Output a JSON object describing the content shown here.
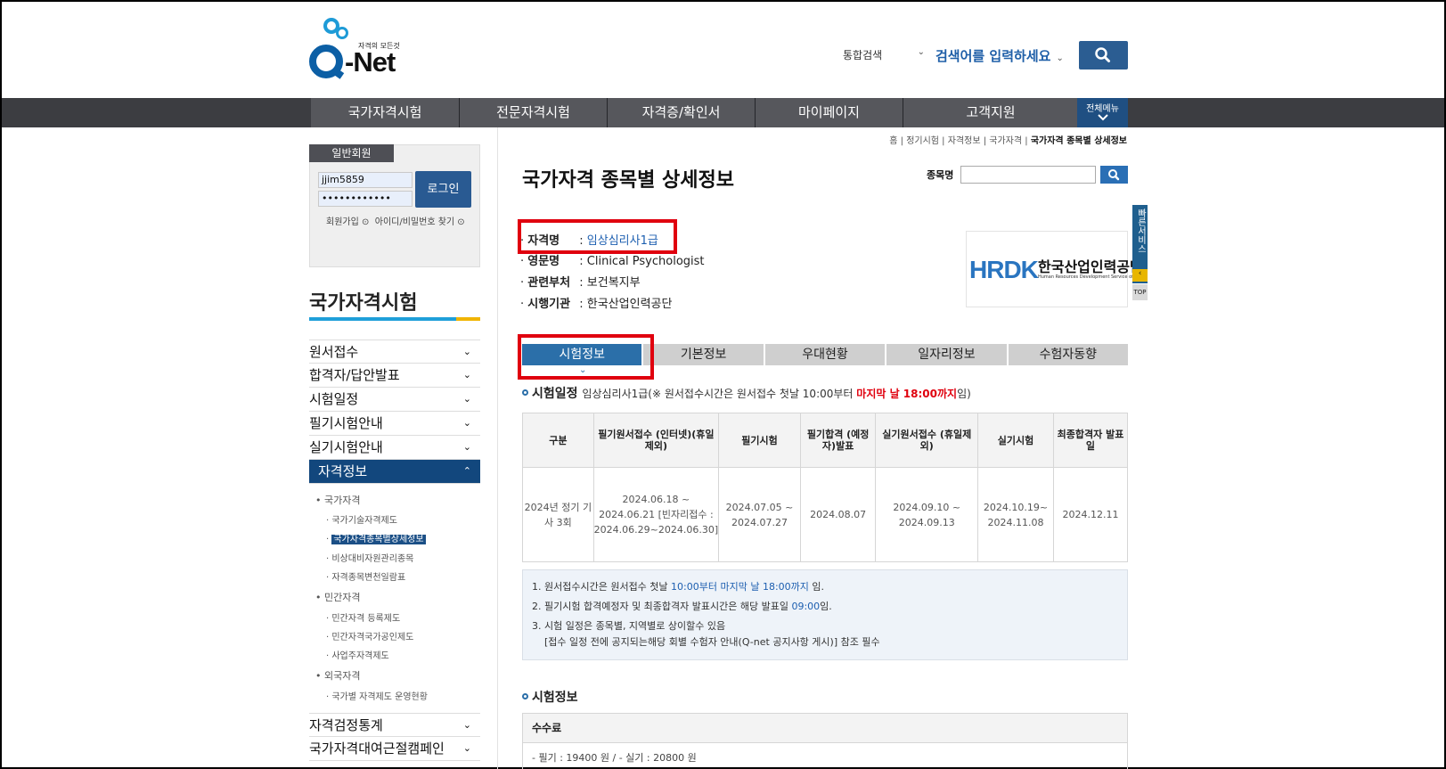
{
  "header": {
    "logo_tagline": "자격의 모든것",
    "logo_text": "-Net",
    "search_category": "통합검색",
    "search_placeholder": "검색어를 입력하세요"
  },
  "nav": {
    "items": [
      "국가자격시험",
      "전문자격시험",
      "자격증/확인서",
      "마이페이지",
      "고객지원"
    ],
    "all_menu": "전체메뉴"
  },
  "login": {
    "member_type": "일반회원",
    "user_id": "jjim5859",
    "password": "••••••••••••",
    "login_button": "로그인",
    "join": "회원가입",
    "find": "아이디/비밀번호 찾기"
  },
  "sidebar": {
    "title": "국가자격시험",
    "menu_top": [
      "원서접수",
      "합격자/답안발표",
      "시험일정",
      "필기시험안내",
      "실기시험안내"
    ],
    "active": "자격정보",
    "sub": [
      {
        "label": "국가자격",
        "level": 1
      },
      {
        "label": "국가기술자격제도",
        "level": 2
      },
      {
        "label": "국가자격종목별상세정보",
        "level": 2,
        "selected": true
      },
      {
        "label": "비상대비자원관리종목",
        "level": 2
      },
      {
        "label": "자격종목변천일람표",
        "level": 2
      },
      {
        "label": "민간자격",
        "level": 1
      },
      {
        "label": "민간자격 등록제도",
        "level": 2
      },
      {
        "label": "민간자격국가공인제도",
        "level": 2
      },
      {
        "label": "사업주자격제도",
        "level": 2
      },
      {
        "label": "외국자격",
        "level": 1
      },
      {
        "label": "국가별 자격제도 운영현황",
        "level": 2
      }
    ],
    "menu_bottom": [
      "자격검정통계",
      "국가자격대여근절캠페인"
    ]
  },
  "breadcrumb": [
    "홈",
    "정기시험",
    "자격정보",
    "국가자격",
    "국가자격 종목별 상세정보"
  ],
  "page": {
    "title": "국가자격 종목별 상세정보",
    "item_search_label": "종목명"
  },
  "info": [
    {
      "key": "자격명",
      "value": "임상심리사1급"
    },
    {
      "key": "영문명",
      "value": "Clinical Psychologist"
    },
    {
      "key": "관련부처",
      "value": "보건복지부"
    },
    {
      "key": "시행기관",
      "value": "한국산업인력공단"
    }
  ],
  "org_logo": {
    "mark": "HRDK",
    "name_kr": "한국산업인력공단",
    "name_en": "Human Resources Development Service of Korea"
  },
  "quick_service": "빠른서비스",
  "top_label": "TOP",
  "tabs": [
    "시험정보",
    "기본정보",
    "우대현황",
    "일자리정보",
    "수험자동향"
  ],
  "schedule": {
    "section_title": "시험일정",
    "note_prefix": "임상심리사1급(※ 원서접수시간은 원서접수 첫날 10:00부터 ",
    "note_red": "마지막 날 18:00까지",
    "note_suffix": "임)",
    "headers": [
      "구분",
      "필기원서접수 (인터넷)(휴일 제외)",
      "필기시험",
      "필기합격 (예정자)발표",
      "실기원서접수 (휴일제외)",
      "실기시험",
      "최종합격자 발표일"
    ],
    "row": [
      "2024년 정기 기사 3회",
      "2024.06.18 ~ 2024.06.21 [빈자리접수 : 2024.06.29~2024.06.30]",
      "2024.07.05 ~ 2024.07.27",
      "2024.08.07",
      "2024.09.10 ~ 2024.09.13",
      "2024.10.19~ 2024.11.08",
      "2024.12.11"
    ]
  },
  "notices": {
    "n1_a": "1. 원서접수시간은 원서접수 첫날 ",
    "n1_b": "10:00부터 마지막 날 18:00까지",
    "n1_c": " 임.",
    "n2_a": "2. 필기시험 합격예정자 및 최종합격자 발표시간은 해당 발표일 ",
    "n2_b": "09:00",
    "n2_c": "임.",
    "n3": "3. 시험 일정은 종목별, 지역별로 상이할수 있음",
    "n3_sub": "[접수 일정 전에 공지되는해당 회별 수험자 안내(Q-net 공지사항 게시)] 참조 필수"
  },
  "exam_info": {
    "section_title": "시험정보",
    "fee_label": "수수료",
    "fee_text": "- 필기 : 19400 원 / - 실기 : 20800 원"
  },
  "colors": {
    "brand": "#2b5d92",
    "nav": "#3c3d41",
    "tab_active": "#2b6fa9",
    "highlight": "#e0000e"
  }
}
